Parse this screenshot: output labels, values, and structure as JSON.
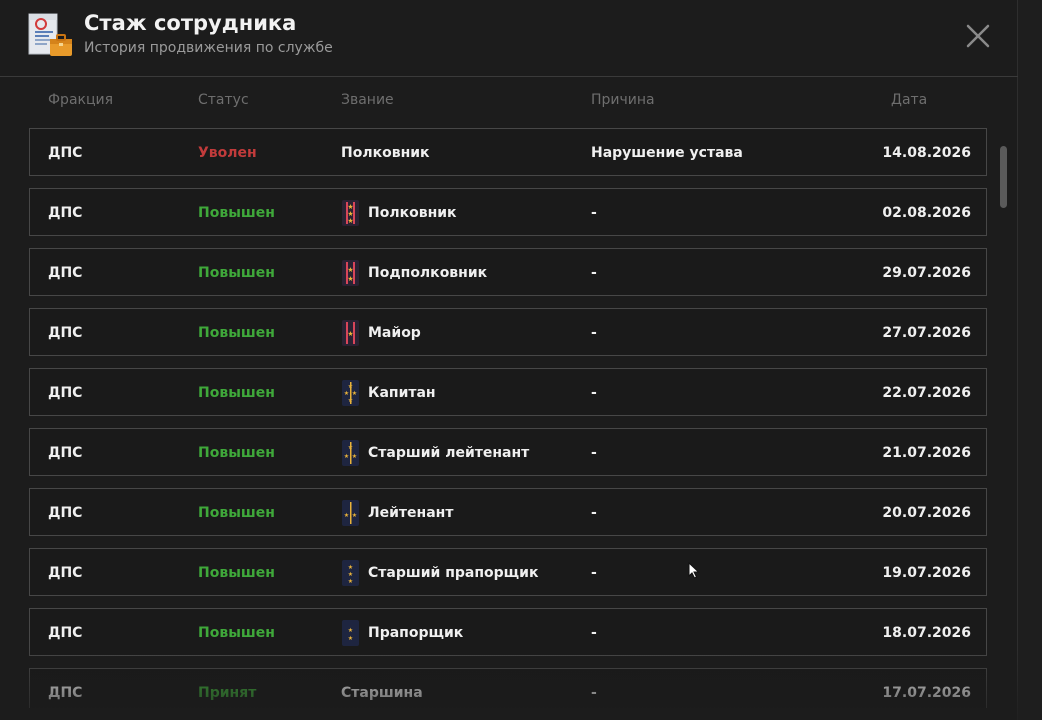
{
  "dialog": {
    "title": "Стаж сотрудника",
    "subtitle": "История продвижения по службе",
    "close_icon": "close-icon",
    "logo_icon": "document-briefcase-icon"
  },
  "columns": {
    "faction": "Фракция",
    "status": "Статус",
    "rank": "Звание",
    "reason": "Причина",
    "date": "Дата"
  },
  "colors": {
    "fired": "#c23b3b",
    "promoted": "#3fa83a",
    "row_border": "#474747",
    "background": "#1c1c1c"
  },
  "rows": [
    {
      "faction": "ДПС",
      "status": "Уволен",
      "status_type": "fired",
      "rank": "Полковник",
      "rank_icon": "",
      "reason": "Нарушение устава",
      "date": "14.08.2026"
    },
    {
      "faction": "ДПС",
      "status": "Повышен",
      "status_type": "promoted",
      "rank": "Полковник",
      "rank_icon": "colonel-insignia-icon",
      "reason": "-",
      "date": "02.08.2026"
    },
    {
      "faction": "ДПС",
      "status": "Повышен",
      "status_type": "promoted",
      "rank": "Подполковник",
      "rank_icon": "lieutenant-colonel-insignia-icon",
      "reason": "-",
      "date": "29.07.2026"
    },
    {
      "faction": "ДПС",
      "status": "Повышен",
      "status_type": "promoted",
      "rank": "Майор",
      "rank_icon": "major-insignia-icon",
      "reason": "-",
      "date": "27.07.2026"
    },
    {
      "faction": "ДПС",
      "status": "Повышен",
      "status_type": "promoted",
      "rank": "Капитан",
      "rank_icon": "captain-insignia-icon",
      "reason": "-",
      "date": "22.07.2026"
    },
    {
      "faction": "ДПС",
      "status": "Повышен",
      "status_type": "promoted",
      "rank": "Старший лейтенант",
      "rank_icon": "senior-lieutenant-insignia-icon",
      "reason": "-",
      "date": "21.07.2026"
    },
    {
      "faction": "ДПС",
      "status": "Повышен",
      "status_type": "promoted",
      "rank": "Лейтенант",
      "rank_icon": "lieutenant-insignia-icon",
      "reason": "-",
      "date": "20.07.2026"
    },
    {
      "faction": "ДПС",
      "status": "Повышен",
      "status_type": "promoted",
      "rank": "Старший прапорщик",
      "rank_icon": "senior-warrant-officer-insignia-icon",
      "reason": "-",
      "date": "19.07.2026"
    },
    {
      "faction": "ДПС",
      "status": "Повышен",
      "status_type": "promoted",
      "rank": "Прапорщик",
      "rank_icon": "warrant-officer-insignia-icon",
      "reason": "-",
      "date": "18.07.2026"
    },
    {
      "faction": "ДПС",
      "status": "Принят",
      "status_type": "hired",
      "rank": "Старшина",
      "rank_icon": "",
      "reason": "-",
      "date": "17.07.2026"
    }
  ]
}
